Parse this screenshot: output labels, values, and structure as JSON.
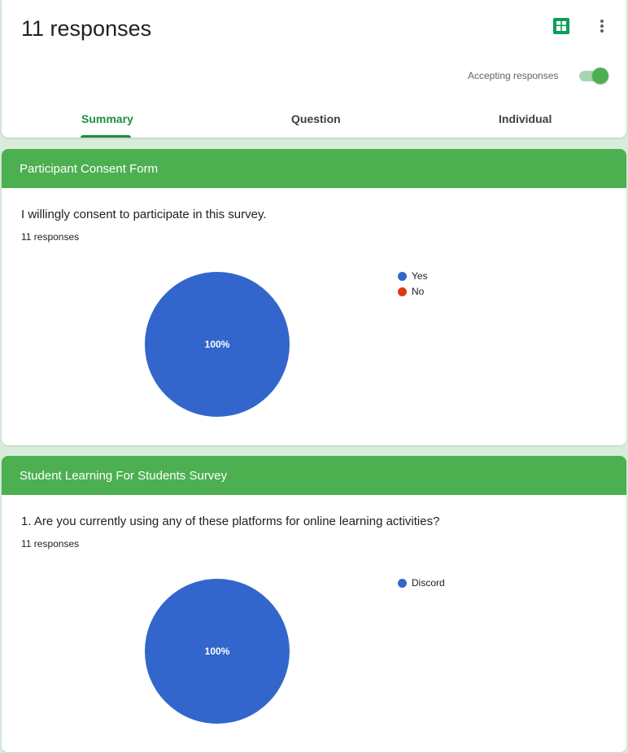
{
  "header": {
    "title": "11 responses",
    "accepting_label": "Accepting responses",
    "accepting_on": true,
    "tabs": [
      {
        "label": "Summary",
        "active": true
      },
      {
        "label": "Question",
        "active": false
      },
      {
        "label": "Individual",
        "active": false
      }
    ],
    "sheets_icon": "google-sheets-icon",
    "more_icon": "more-vert-icon"
  },
  "sections": [
    {
      "title": "Participant Consent Form",
      "question": "I willingly consent to participate in this survey.",
      "responses": "11 responses",
      "pie_label": "100%",
      "legend": [
        {
          "label": "Yes",
          "color": "#3366cc"
        },
        {
          "label": "No",
          "color": "#dc3912"
        }
      ]
    },
    {
      "title": "Student Learning For Students Survey",
      "question": "1. Are you currently using any of these platforms for online learning activities?",
      "responses": "11 responses",
      "pie_label": "100%",
      "legend": [
        {
          "label": "Discord",
          "color": "#3366cc"
        }
      ]
    }
  ],
  "chart_data": [
    {
      "type": "pie",
      "categories": [
        "Yes",
        "No"
      ],
      "values": [
        100,
        0
      ]
    },
    {
      "type": "pie",
      "categories": [
        "Discord"
      ],
      "values": [
        100
      ]
    }
  ],
  "colors": {
    "accent": "#4caf50",
    "tab_active": "#1e8e3e",
    "pie_blue": "#3366cc",
    "pie_red": "#dc3912"
  }
}
